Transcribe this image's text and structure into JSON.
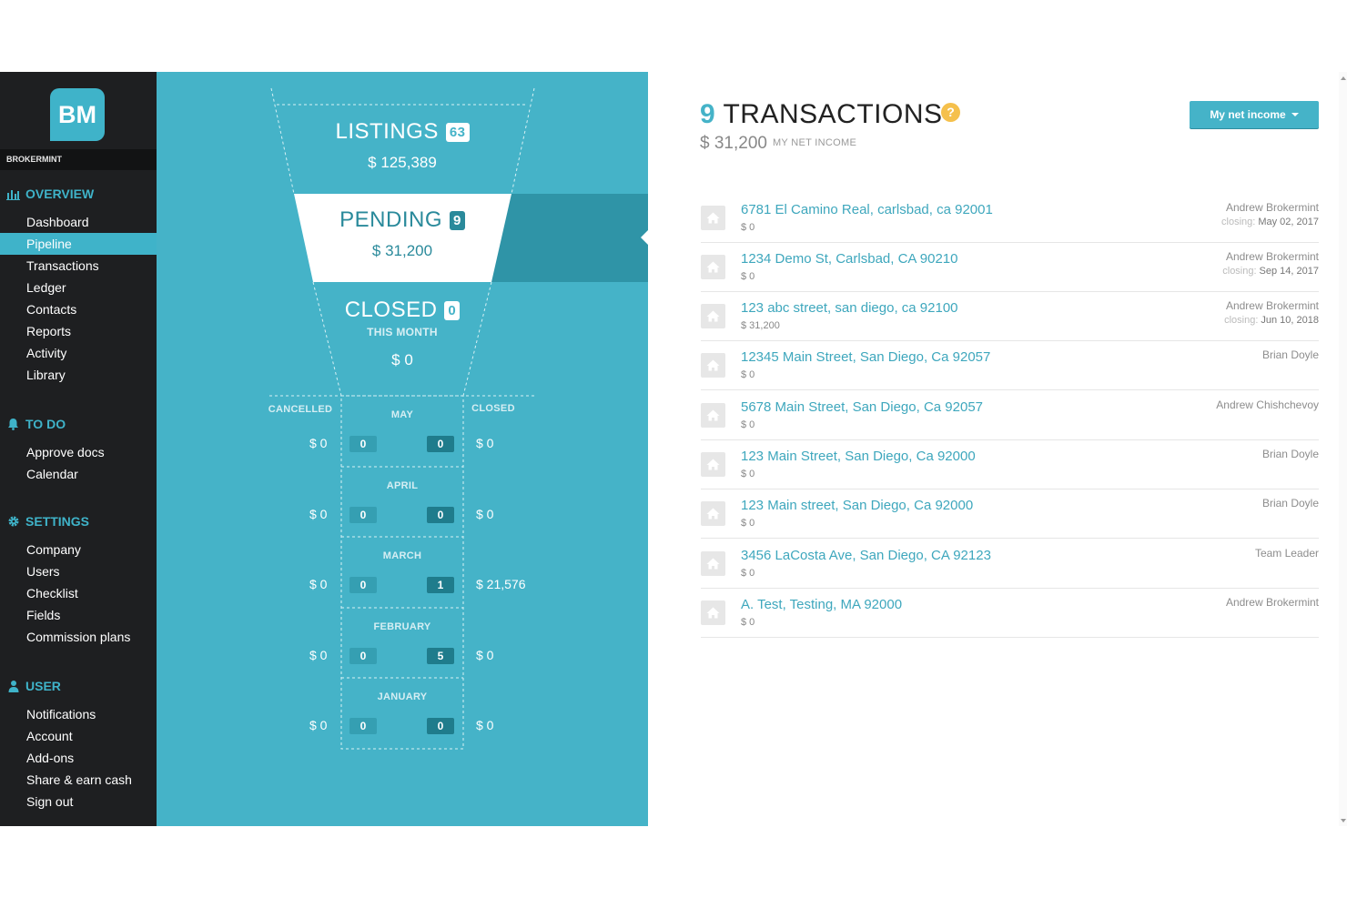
{
  "brand": {
    "logo": "BM",
    "name": "BROKERMINT"
  },
  "sidebar": {
    "sections": [
      {
        "title": "OVERVIEW",
        "icon": "bar-chart-icon",
        "items": [
          "Dashboard",
          "Pipeline",
          "Transactions",
          "Ledger",
          "Contacts",
          "Reports",
          "Activity",
          "Library"
        ]
      },
      {
        "title": "TO DO",
        "icon": "bell-icon",
        "items": [
          "Approve docs",
          "Calendar"
        ]
      },
      {
        "title": "SETTINGS",
        "icon": "gear-icon",
        "items": [
          "Company",
          "Users",
          "Checklist",
          "Fields",
          "Commission plans"
        ]
      },
      {
        "title": "USER",
        "icon": "user-icon",
        "items": [
          "Notifications",
          "Account",
          "Add-ons",
          "Share & earn cash",
          "Sign out"
        ]
      }
    ],
    "active": "Pipeline"
  },
  "funnel": {
    "listings": {
      "label": "LISTINGS",
      "count": "63",
      "amount": "$ 125,389"
    },
    "pending": {
      "label": "PENDING",
      "count": "9",
      "amount": "$ 31,200"
    },
    "closed": {
      "label": "CLOSED",
      "count": "0",
      "sublabel": "THIS MONTH",
      "amount": "$ 0"
    },
    "columns": {
      "left": "CANCELLED",
      "right": "CLOSED"
    },
    "months": [
      {
        "name": "MAY",
        "cancelled_amount": "$ 0",
        "cancelled_count": "0",
        "closed_count": "0",
        "closed_amount": "$ 0"
      },
      {
        "name": "APRIL",
        "cancelled_amount": "$ 0",
        "cancelled_count": "0",
        "closed_count": "0",
        "closed_amount": "$ 0"
      },
      {
        "name": "MARCH",
        "cancelled_amount": "$ 0",
        "cancelled_count": "0",
        "closed_count": "1",
        "closed_amount": "$ 21,576"
      },
      {
        "name": "FEBRUARY",
        "cancelled_amount": "$ 0",
        "cancelled_count": "0",
        "closed_count": "5",
        "closed_amount": "$ 0"
      },
      {
        "name": "JANUARY",
        "cancelled_amount": "$ 0",
        "cancelled_count": "0",
        "closed_count": "0",
        "closed_amount": "$ 0"
      }
    ]
  },
  "main": {
    "count": "9",
    "title": "TRANSACTIONS",
    "help": "?",
    "net_amount": "$ 31,200",
    "net_label": "MY NET INCOME",
    "button_label": "My net income",
    "closing_label": "closing:",
    "transactions": [
      {
        "address": "6781 El Camino Real, carlsbad, ca 92001",
        "amount": "$ 0",
        "agent": "Andrew Brokermint",
        "closing": "May 02, 2017"
      },
      {
        "address": "1234 Demo St, Carlsbad, CA 90210",
        "amount": "$ 0",
        "agent": "Andrew Brokermint",
        "closing": "Sep 14, 2017"
      },
      {
        "address": "123 abc street, san diego, ca 92100",
        "amount": "$ 31,200",
        "agent": "Andrew Brokermint",
        "closing": "Jun 10, 2018"
      },
      {
        "address": "12345 Main Street, San Diego, Ca 92057",
        "amount": "$ 0",
        "agent": "Brian Doyle",
        "closing": ""
      },
      {
        "address": "5678 Main Street, San Diego, Ca 92057",
        "amount": "$ 0",
        "agent": "Andrew Chishchevoy",
        "closing": ""
      },
      {
        "address": "123 Main Street, San Diego, Ca 92000",
        "amount": "$ 0",
        "agent": "Brian Doyle",
        "closing": ""
      },
      {
        "address": "123 Main street, San Diego, Ca 92000",
        "amount": "$ 0",
        "agent": "Brian Doyle",
        "closing": ""
      },
      {
        "address": "3456 LaCosta Ave, San Diego, CA 92123",
        "amount": "$ 0",
        "agent": "Team Leader",
        "closing": ""
      },
      {
        "address": "A. Test, Testing, MA 92000",
        "amount": "$ 0",
        "agent": "Andrew Brokermint",
        "closing": ""
      }
    ]
  },
  "colors": {
    "accent": "#45b3c8",
    "sidebar": "#1e1f21",
    "link": "#3ea7bd",
    "help": "#f5c04c"
  }
}
